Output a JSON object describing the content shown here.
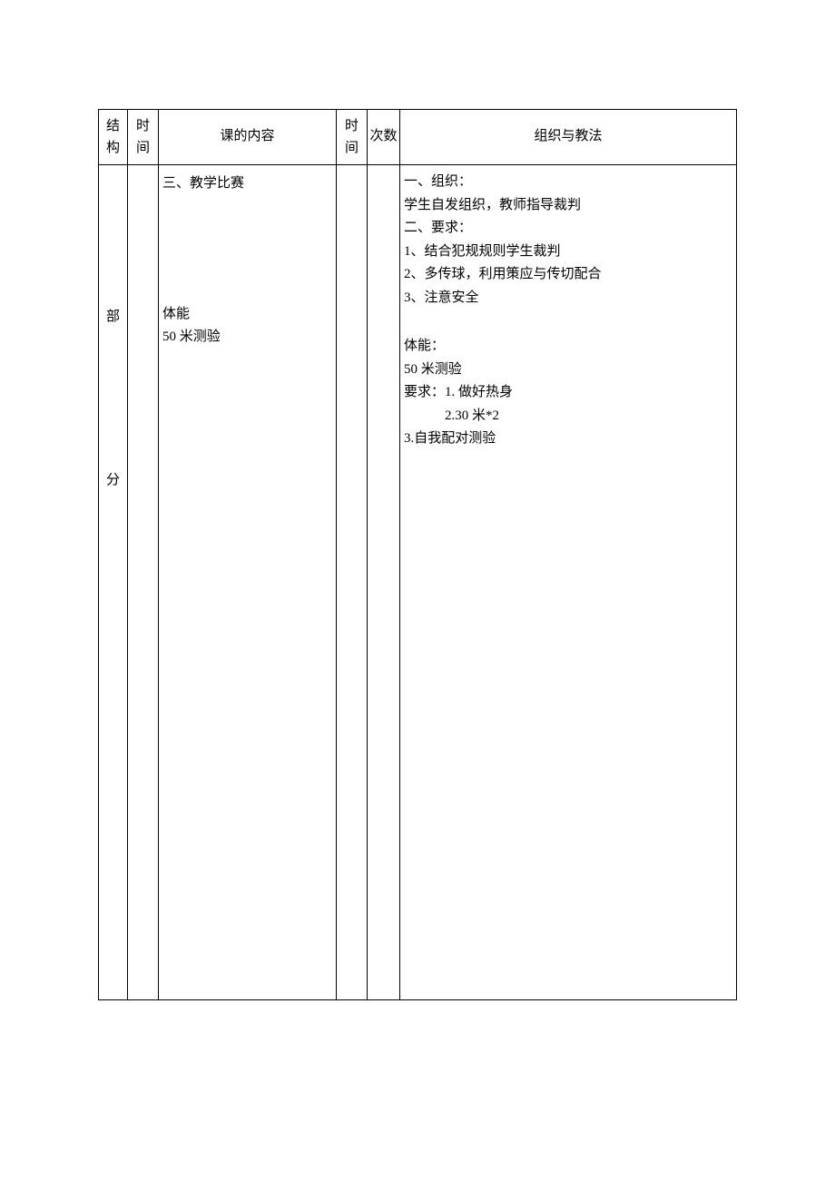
{
  "headers": {
    "structure_1": "结",
    "structure_2": "构",
    "time1_1": "时",
    "time1_2": "间",
    "content": "课的内容",
    "time2_1": "时",
    "time2_2": "间",
    "count": "次数",
    "method": "组织与教法"
  },
  "structure": {
    "char1": "部",
    "char2": "分"
  },
  "content": {
    "section1_line1": "三、教学比赛",
    "section2_line1": "体能",
    "section2_line2": "50 米测验"
  },
  "method": {
    "section1": {
      "line1": "一、组织：",
      "line2": "学生自发组织，教师指导裁判",
      "line3": "二、要求：",
      "line4": "1、结合犯规规则学生裁判",
      "line5": "2、多传球，利用策应与传切配合",
      "line6": "3、注意安全"
    },
    "section2": {
      "line1": "体能：",
      "line2": "50 米测验",
      "line3": "要求：1. 做好热身",
      "line4": "2.30 米*2",
      "line5": "3.自我配对测验"
    }
  }
}
